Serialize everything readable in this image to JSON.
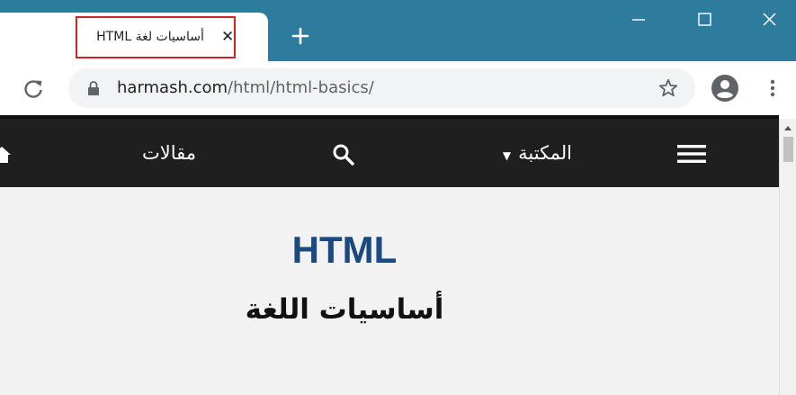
{
  "browser": {
    "tab": {
      "title": "أساسيات لغة HTML",
      "close_symbol": "✕"
    },
    "address_bar": {
      "host": "harmash.com",
      "path": "/html/html-basics/"
    }
  },
  "site_nav": {
    "articles_label": "مقالات",
    "library_label": "المكتبة",
    "library_caret": "▼"
  },
  "content": {
    "heading": "HTML",
    "subheading": "أساسيات اللغة"
  },
  "colors": {
    "titlebar": "#2e7c9d",
    "nav_background": "#1f1f1f",
    "heading": "#1a4a80",
    "tab_highlight": "#c62828"
  },
  "icons": {
    "new_tab": "plus-icon",
    "minimize": "minimize-icon",
    "maximize": "maximize-icon",
    "close": "close-icon",
    "reload": "reload-icon",
    "lock": "lock-icon",
    "bookmark": "star-icon",
    "profile": "account-icon",
    "menu": "kebab-menu-icon",
    "home": "home-icon",
    "search": "search-icon",
    "hamburger": "hamburger-icon"
  }
}
